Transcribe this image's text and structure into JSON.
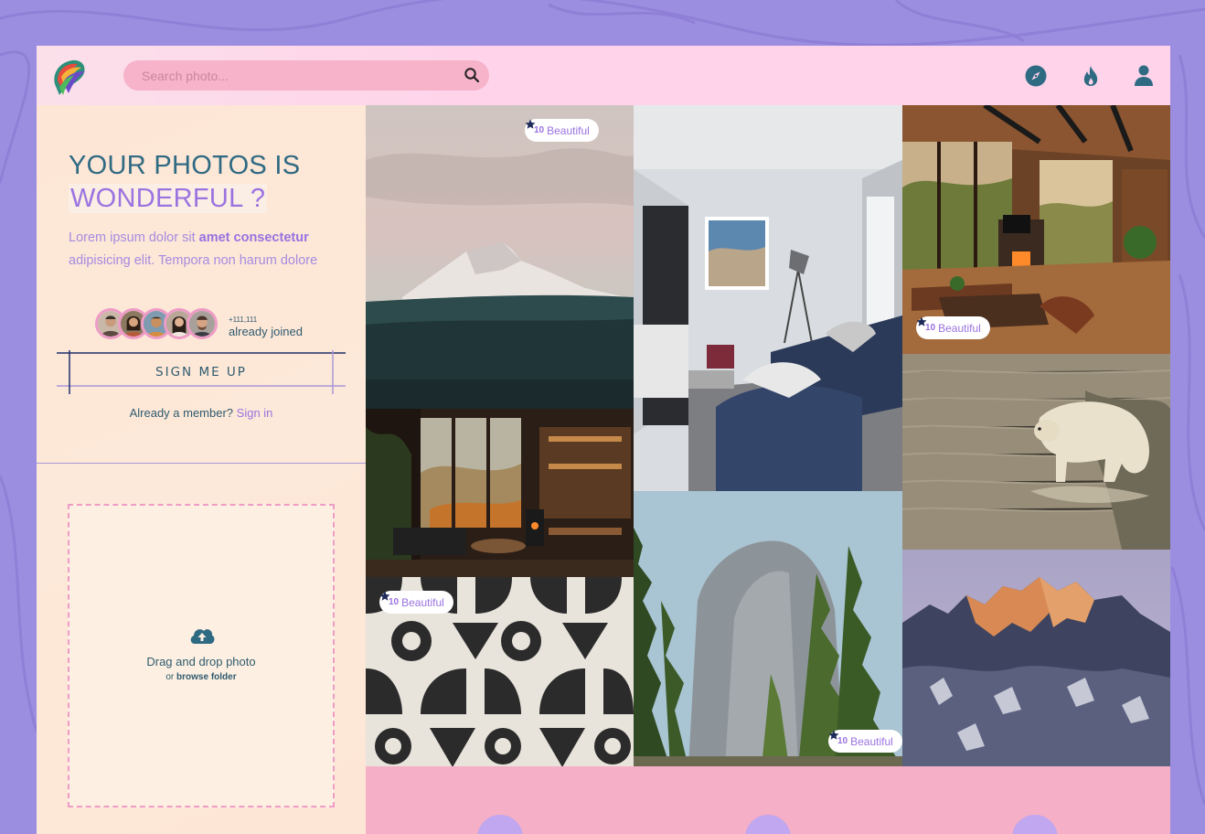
{
  "header": {
    "search_placeholder": "Search photo..."
  },
  "hero": {
    "title_line1": "YOUR PHOTOS IS",
    "title_line2": "WONDERFUL ?",
    "desc_pre": "Lorem ipsum dolor sit ",
    "desc_bold": "amet consectetur",
    "desc_post": " adipisicing elit. Tempora non harum dolore",
    "joined_count": "+111,111",
    "joined_label": "already joined",
    "signup_label": "SIGN ME UP",
    "member_text": "Already a member? ",
    "signin_label": "Sign in"
  },
  "upload": {
    "title": "Drag and drop photo",
    "sub_pre": "or ",
    "sub_link": "browse folder"
  },
  "badges": {
    "b1": {
      "num": "10",
      "label": "Beautiful"
    },
    "b2": {
      "num": "10",
      "label": "Beautiful"
    },
    "b3": {
      "num": "10",
      "label": "Beautiful"
    },
    "b4": {
      "num": "10",
      "label": "Beautiful"
    }
  },
  "colors": {
    "accent_teal": "#2f6a83",
    "accent_purple": "#9b73e0",
    "header_pink": "#ffd3ea",
    "panel_peach": "#fde9d9"
  }
}
